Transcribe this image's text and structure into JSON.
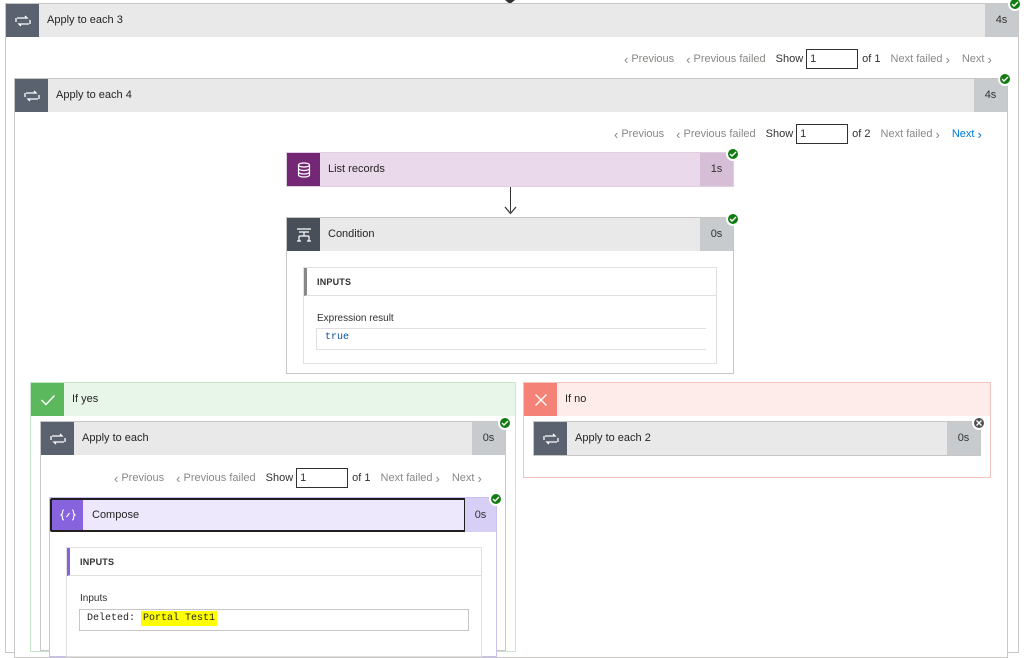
{
  "apply3": {
    "title": "Apply to each 3",
    "duration": "4s"
  },
  "pager3": {
    "previous": "Previous",
    "previous_failed": "Previous failed",
    "show": "Show",
    "value": "1",
    "of": "of 1",
    "next_failed": "Next failed",
    "next": "Next"
  },
  "apply4": {
    "title": "Apply to each 4",
    "duration": "4s"
  },
  "pager4": {
    "previous": "Previous",
    "previous_failed": "Previous failed",
    "show": "Show",
    "value": "1",
    "of": "of 2",
    "next_failed": "Next failed",
    "next": "Next"
  },
  "list_records": {
    "title": "List records",
    "duration": "1s"
  },
  "condition": {
    "title": "Condition",
    "duration": "0s",
    "inputs_label": "INPUTS",
    "expression_label": "Expression result",
    "expression_value": "true"
  },
  "if_yes": {
    "label": "If yes"
  },
  "if_no": {
    "label": "If no"
  },
  "apply1": {
    "title": "Apply to each",
    "duration": "0s"
  },
  "pager1": {
    "previous": "Previous",
    "previous_failed": "Previous failed",
    "show": "Show",
    "value": "1",
    "of": "of 1",
    "next_failed": "Next failed",
    "next": "Next"
  },
  "compose": {
    "title": "Compose",
    "duration": "0s",
    "inputs_label": "INPUTS",
    "field_label": "Inputs",
    "value_prefix": "Deleted:",
    "value_highlight": "Portal Test1"
  },
  "apply2": {
    "title": "Apply to each 2",
    "duration": "0s"
  },
  "colors": {
    "header_gray": "#e9e9ea",
    "icon_gray": "#5a6270",
    "dataverse_purple": "#742774",
    "compose_purple": "#8764dd",
    "yes_green": "#5cb85c",
    "no_red": "#f58277",
    "success": "#107c10",
    "highlight": "#ffff00",
    "link_blue": "#0078d4"
  }
}
